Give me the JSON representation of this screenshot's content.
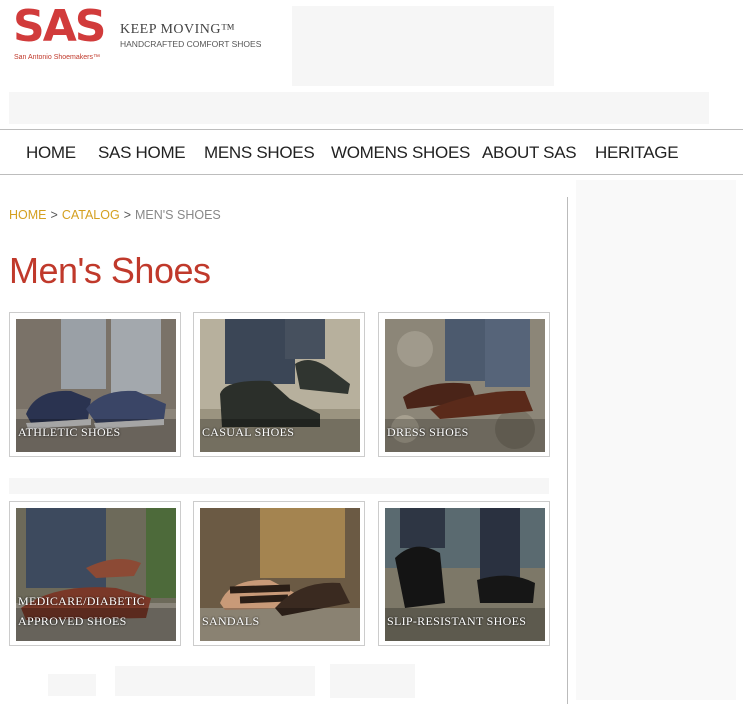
{
  "brand": {
    "logo_text": "SAS",
    "logo_subtitle": "San Antonio Shoemakers™",
    "tagline": "KEEP MOVING™",
    "tagline_sub": "HANDCRAFTED COMFORT SHOES",
    "accent": "#d13b3b"
  },
  "nav": {
    "items": [
      {
        "label": "HOME"
      },
      {
        "label": "SAS HOME"
      },
      {
        "label": "MENS SHOES"
      },
      {
        "label": "WOMENS SHOES"
      },
      {
        "label": "ABOUT SAS"
      },
      {
        "label": "HERITAGE"
      }
    ]
  },
  "breadcrumb": {
    "home": "HOME",
    "catalog": "CATALOG",
    "separator": ">",
    "current": "MEN'S SHOES",
    "link_color": "#d4a020"
  },
  "page": {
    "title": "Men's Shoes",
    "title_color": "#c0392b"
  },
  "categories": [
    {
      "label": "ATHLETIC SHOES",
      "icon": "athletic-shoe-image"
    },
    {
      "label": "CASUAL SHOES",
      "icon": "casual-shoe-image"
    },
    {
      "label": "DRESS SHOES",
      "icon": "dress-shoe-image"
    },
    {
      "label": "MEDICARE/DIABETIC APPROVED SHOES",
      "icon": "boat-shoe-image"
    },
    {
      "label": "SANDALS",
      "icon": "sandal-image"
    },
    {
      "label": "SLIP-RESISTANT SHOES",
      "icon": "slip-resistant-shoe-image"
    }
  ]
}
